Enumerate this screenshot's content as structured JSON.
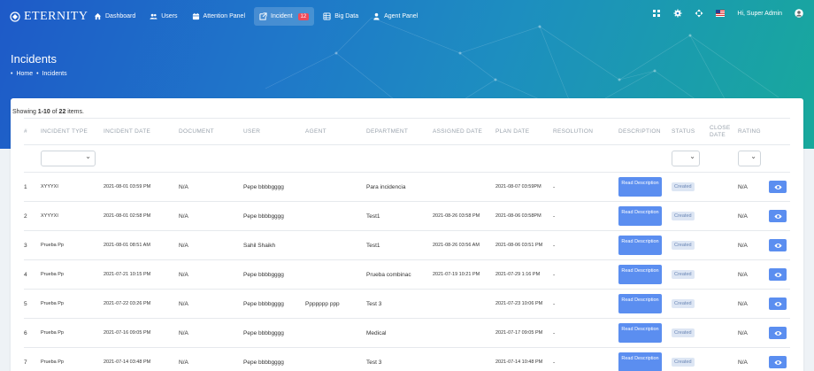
{
  "header": {
    "logo_text": "ETERNITY",
    "nav": [
      {
        "label": "Dashboard",
        "icon": "home-icon"
      },
      {
        "label": "Users",
        "icon": "users-icon"
      },
      {
        "label": "Attention Panel",
        "icon": "calendar-icon"
      },
      {
        "label": "Incident",
        "icon": "external-link-icon",
        "badge": "12",
        "active": true
      },
      {
        "label": "Big Data",
        "icon": "database-icon"
      },
      {
        "label": "Agent Panel",
        "icon": "agent-icon"
      }
    ],
    "greeting": "Hi, Super Admin"
  },
  "page": {
    "title": "Incidents",
    "breadcrumb": [
      "Home",
      "Incidents"
    ]
  },
  "summary": {
    "prefix": "Showing ",
    "range": "1-10",
    "mid": " of ",
    "total": "22",
    "suffix": " items."
  },
  "table": {
    "columns": [
      "#",
      "Incident Type",
      "Incident Date",
      "Document",
      "User",
      "Agent",
      "Department",
      "Assigned Date",
      "Plan Date",
      "Resolution",
      "Description",
      "Status",
      "Close Date",
      "Rating",
      ""
    ],
    "desc_label": "Read Description",
    "rows": [
      {
        "num": "1",
        "type": "XYYYXI",
        "date": "2021-08-01 03:59 PM",
        "doc": "N/A",
        "user": "Pepe bbbbgggg",
        "agent": "",
        "dept": "Para incidencia",
        "assigned": "",
        "plan": "2021-08-07 03:59PM",
        "res": "-",
        "status": "Created",
        "close": "",
        "rating": "N/A"
      },
      {
        "num": "2",
        "type": "XYYYXI",
        "date": "2021-08-01 02:58 PM",
        "doc": "N/A",
        "user": "Pepe bbbbgggg",
        "agent": "",
        "dept": "Test1",
        "assigned": "2021-08-26 03:58 PM",
        "plan": "2021-08-06 03:58PM",
        "res": "-",
        "status": "Created",
        "close": "",
        "rating": "N/A"
      },
      {
        "num": "3",
        "type": "Prueba Pp",
        "date": "2021-08-01 08:51 AM",
        "doc": "N/A",
        "user": "Sahil Shaikh",
        "agent": "",
        "dept": "Test1",
        "assigned": "2021-08-26 03:56 AM",
        "plan": "2021-08-06 03:51 PM",
        "res": "-",
        "status": "Created",
        "close": "",
        "rating": "N/A"
      },
      {
        "num": "4",
        "type": "Prueba Pp",
        "date": "2021-07-21 10:15 PM",
        "doc": "N/A",
        "user": "Pepe bbbbgggg",
        "agent": "",
        "dept": "Prueba combinac",
        "assigned": "2021-07-19 10:21 PM",
        "plan": "2021-07-29 1:16 PM",
        "res": "-",
        "status": "Created",
        "close": "",
        "rating": "N/A"
      },
      {
        "num": "5",
        "type": "Prueba Pp",
        "date": "2021-07-22 03:26 PM",
        "doc": "N/A",
        "user": "Pepe bbbbgggg",
        "agent": "Ppppppp ppp",
        "dept": "Test 3",
        "assigned": "",
        "plan": "2021-07-23 10:06 PM",
        "res": "-",
        "status": "Created",
        "close": "",
        "rating": "N/A"
      },
      {
        "num": "6",
        "type": "Prueba Pp",
        "date": "2021-07-16 09:05 PM",
        "doc": "N/A",
        "user": "Pepe bbbbgggg",
        "agent": "",
        "dept": "Medical",
        "assigned": "",
        "plan": "2021-07-17 09:05 PM",
        "res": "-",
        "status": "Created",
        "close": "",
        "rating": "N/A"
      },
      {
        "num": "7",
        "type": "Prueba Pp",
        "date": "2021-07-14 03:48 PM",
        "doc": "N/A",
        "user": "Pepe bbbbgggg",
        "agent": "",
        "dept": "Test 3",
        "assigned": "",
        "plan": "2021-07-14 10:48 PM",
        "res": "-",
        "status": "Created",
        "close": "",
        "rating": "N/A"
      }
    ]
  },
  "colors": {
    "accent": "#5b8ef0",
    "hero_start": "#1e5ac8",
    "hero_end": "#18a99c",
    "badge": "#f04a5a"
  }
}
